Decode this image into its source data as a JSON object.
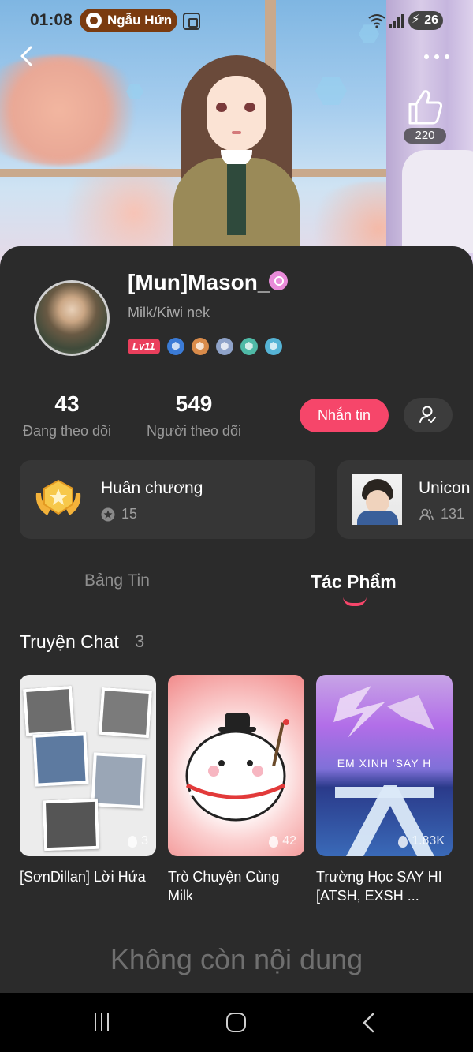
{
  "status_bar": {
    "time": "01:08",
    "app_pill": "Ngẫu Hứn",
    "battery": "26"
  },
  "header": {
    "like_count": "220"
  },
  "profile": {
    "username": "[Mun]Mason_",
    "bio": "Milk/Kiwi nek",
    "level": "Lv11",
    "badge_colors": [
      "#3b7bd6",
      "#d98b4a",
      "#8fa3c9",
      "#4fb9a6",
      "#56b4d6"
    ]
  },
  "stats": {
    "following_count": "43",
    "following_label": "Đang theo dõi",
    "followers_count": "549",
    "followers_label": "Người theo dõi"
  },
  "actions": {
    "message_label": "Nhắn tin"
  },
  "cards": {
    "medal": {
      "title": "Huân chương",
      "count": "15"
    },
    "club": {
      "title": "Unicon",
      "count": "131"
    }
  },
  "tabs": {
    "feed": "Bảng Tin",
    "works": "Tác Phẩm",
    "active": "works"
  },
  "section": {
    "title": "Truyện Chat",
    "count": "3"
  },
  "stories": [
    {
      "title": "[SơnDillan] Lời Hứa",
      "plays": "3"
    },
    {
      "title": "Trò Chuyện Cùng Milk",
      "plays": "42"
    },
    {
      "title": "Trường Học SAY HI [ATSH, EXSH ...",
      "plays": "1.83K",
      "banner_text": "EM XINH 'SAY H"
    }
  ],
  "empty_state": "Không còn nội dung",
  "colors": {
    "accent": "#f6466a",
    "panel": "#2b2b2b",
    "card": "#363636"
  }
}
